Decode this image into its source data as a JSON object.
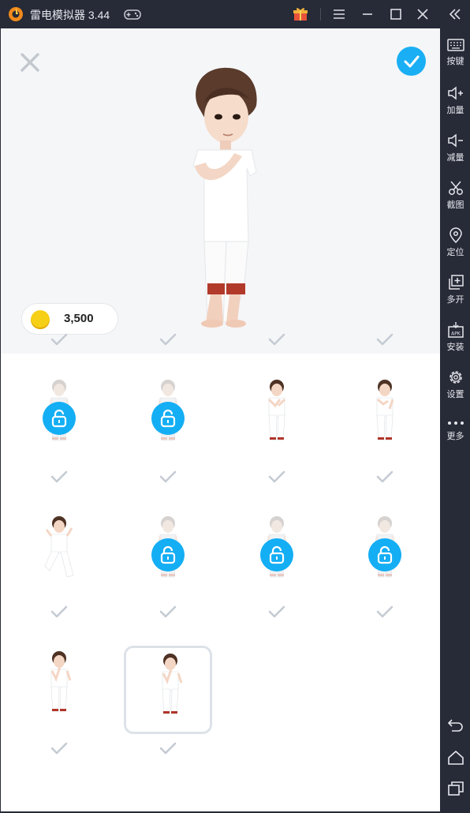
{
  "window": {
    "title": "雷电模拟器 3.44",
    "accent": "#1aaff4"
  },
  "sidebar": {
    "items": [
      {
        "label": "按键",
        "icon": "keyboard-icon"
      },
      {
        "label": "加量",
        "icon": "volume-up-icon"
      },
      {
        "label": "减量",
        "icon": "volume-down-icon"
      },
      {
        "label": "截图",
        "icon": "scissors-icon"
      },
      {
        "label": "定位",
        "icon": "location-pin-icon"
      },
      {
        "label": "多开",
        "icon": "multi-instance-icon"
      },
      {
        "label": "安装",
        "icon": "apk-install-icon"
      },
      {
        "label": "设置",
        "icon": "gear-icon"
      },
      {
        "label": "更多",
        "icon": "more-dots-icon"
      }
    ],
    "system_buttons": [
      "back-icon",
      "home-icon",
      "recents-icon"
    ]
  },
  "hero": {
    "coins": "3,500"
  },
  "poses": {
    "rows": [
      [
        {
          "locked": false,
          "pose": "partial"
        },
        {
          "locked": false,
          "pose": "partial"
        },
        {
          "locked": false,
          "pose": "partial"
        },
        {
          "locked": false,
          "pose": "partial"
        }
      ],
      [
        {
          "locked": true,
          "pose": "stand"
        },
        {
          "locked": true,
          "pose": "stand"
        },
        {
          "locked": false,
          "pose": "pray"
        },
        {
          "locked": false,
          "pose": "shy"
        }
      ],
      [
        {
          "locked": false,
          "pose": "dance"
        },
        {
          "locked": true,
          "pose": "stand"
        },
        {
          "locked": true,
          "pose": "stand"
        },
        {
          "locked": true,
          "pose": "stand"
        }
      ],
      [
        {
          "locked": false,
          "pose": "think"
        },
        {
          "locked": false,
          "pose": "think",
          "selected": true
        }
      ]
    ]
  }
}
